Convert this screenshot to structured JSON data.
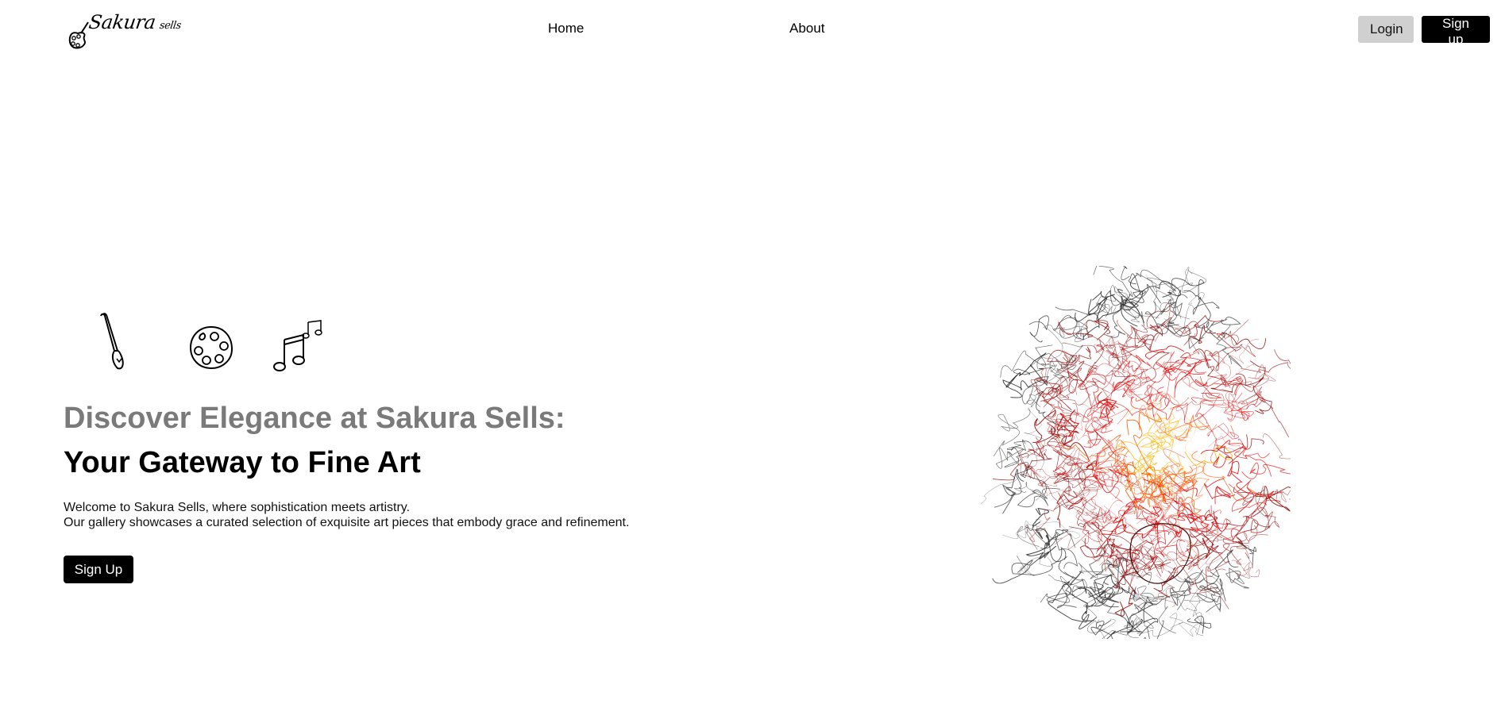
{
  "brand": {
    "name": "Sakura",
    "name_suffix": "sells",
    "icon": "palette-icon"
  },
  "nav": {
    "home": "Home",
    "about": "About"
  },
  "auth": {
    "login": "Login",
    "signup": "Sign up"
  },
  "hero": {
    "icons": [
      "paintbrush-icon",
      "palette-icon",
      "music-notes-icon"
    ],
    "title_line1": "Discover Elegance at Sakura Sells:",
    "title_line2": "Your Gateway to Fine Art",
    "description_line1": "Welcome to Sakura Sells, where sophistication meets artistry.",
    "description_line2": "Our gallery showcases a curated selection of exquisite art pieces that embody grace and refinement.",
    "cta": "Sign Up",
    "artwork": "screaming-face-line-art"
  },
  "colors": {
    "title_muted": "#7a7a7a",
    "primary_button": "#000000",
    "secondary_button": "#d0d0d0",
    "art_glow": "#ff8a00",
    "art_red": "#d10000"
  }
}
